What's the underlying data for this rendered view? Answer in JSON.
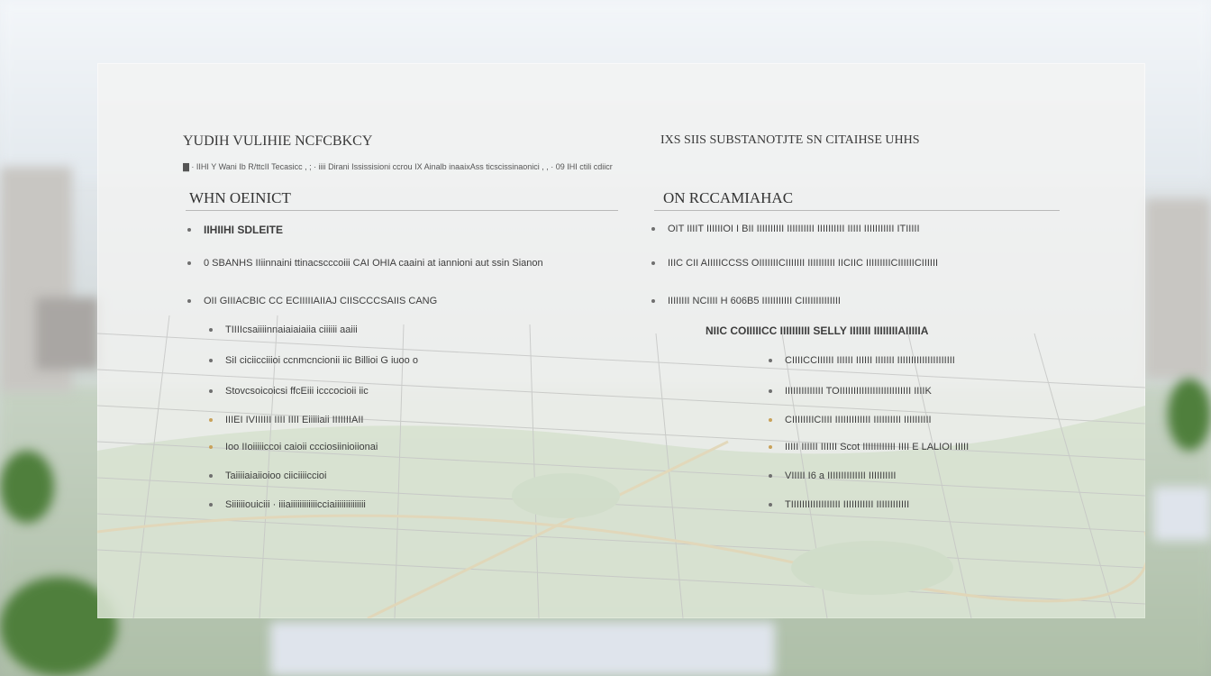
{
  "title": "",
  "left": {
    "subtitle": "YUDIH VULIHIE NCFCBKCY",
    "fine_print": "▇ · IIHI Y Wani Ib R/ttcII Tecasicc , ; · iiii Dirani Ississisioni ccrou IX Ainalb inaaixAss ticscissinaonici , , · 09 IHI ctili cdiicr",
    "heading": "WHN OEINICT",
    "items": [
      {
        "text": "IIHIIHI SDLEITE",
        "level": 0,
        "style": "bold",
        "bullet": "gray"
      },
      {
        "text": "0 SBANHS IIiinnaini ttinacscccoiii CAI OHIA caaini at iannioni aut ssin Sianon",
        "level": 0,
        "style": "normal",
        "bullet": "gray"
      },
      {
        "text": "OII GIIIACBIC CC ECIIIIIAIIAJ CIISCCCSAIIS CANG",
        "level": 0,
        "style": "normal",
        "bullet": "gray"
      },
      {
        "text": "TIIIIcsaiiiinnaiaiaiaiia ciiiiii aaiii",
        "level": 1,
        "style": "normal",
        "bullet": "gray"
      },
      {
        "text": "SiI ciciicciiioi ccnmcncionii iic Billioi G iuoo o",
        "level": 1,
        "style": "normal",
        "bullet": "gray"
      },
      {
        "text": "Stovcsoicoicsi ffcEiii icccocioii iic",
        "level": 1,
        "style": "normal",
        "bullet": "gray"
      },
      {
        "text": "IIIEI IVIIIIII IIII IIII Eiiiiiaii IIIIIIIAII",
        "level": 1,
        "style": "normal",
        "bullet": "accent"
      },
      {
        "text": "Ioo IIoiiiiiccoi caioii ccciosiinioiionai",
        "level": 1,
        "style": "normal",
        "bullet": "accent"
      },
      {
        "text": "Taiiiiaiaiioioo ciiciiiiccioi",
        "level": 1,
        "style": "normal",
        "bullet": "gray"
      },
      {
        "text": "Siiiiiiouiciii · iiiaiiiiiiiiiiiicciaiiiiiiiiiiiiii",
        "level": 1,
        "style": "normal",
        "bullet": "gray"
      }
    ]
  },
  "right": {
    "subtitle": "IXS SIIS SUBSTANOTJTE SN CITAIHSE UHHS",
    "heading": "ON RCCAMIAHAC",
    "items": [
      {
        "text": "OIT IIIIT IIIIIIOI I BII IIIIIIIIII IIIIIIIIII IIIIIIIIII IIIII IIIIIIIIIII ITIIIII",
        "level": 0,
        "style": "normal",
        "bullet": "gray"
      },
      {
        "text": "IIIC CII AIIIIICCSS OIIIIIIICIIIIIII IIIIIIIIII IICIIC IIIIIIIIICIIIIIICIIIIII",
        "level": 0,
        "style": "normal",
        "bullet": "gray"
      },
      {
        "text": "IIIIIIII NCIIII H 606B5 IIIIIIIIIII CIIIIIIIIIIIIII",
        "level": 0,
        "style": "normal",
        "bullet": "gray"
      },
      {
        "text": "NIIC COIIIIICC IIIIIIIIII SELLY IIIIIII IIIIIIIIAIIIIIA",
        "level": 1,
        "style": "bold",
        "bullet": "none"
      },
      {
        "text": "CIIIICCIIIIII IIIIII IIIIII IIIIIII IIIIIIIIIIIIIIIIIIIII",
        "level": 2,
        "style": "normal",
        "bullet": "gray"
      },
      {
        "text": "IIIIIIIIIIIIII TOIIIIIIIIIIIIIIIIIIIIIIIIII IIIIK",
        "level": 2,
        "style": "normal",
        "bullet": "gray"
      },
      {
        "text": "CIIIIIIIICIIII IIIIIIIIIIIII IIIIIIIIII IIIIIIIIII",
        "level": 2,
        "style": "normal",
        "bullet": "accent"
      },
      {
        "text": "IIIII IIIIII IIIIII Scot IIIIIIIIIIII IIII E LALIOI IIIII",
        "level": 2,
        "style": "normal",
        "bullet": "accent"
      },
      {
        "text": "VIIIII I6 a IIIIIIIIIIIIII IIIIIIIIII",
        "level": 2,
        "style": "normal",
        "bullet": "gray"
      },
      {
        "text": "TIIIIIIIIIIIIIIIIII IIIIIIIIIII IIIIIIIIIIII",
        "level": 2,
        "style": "normal",
        "bullet": "gray"
      }
    ]
  },
  "colors": {
    "panel": "#f4f4f2",
    "text": "#2a2a2a",
    "accent": "#c9a25a",
    "green": "#4f7f3c"
  }
}
